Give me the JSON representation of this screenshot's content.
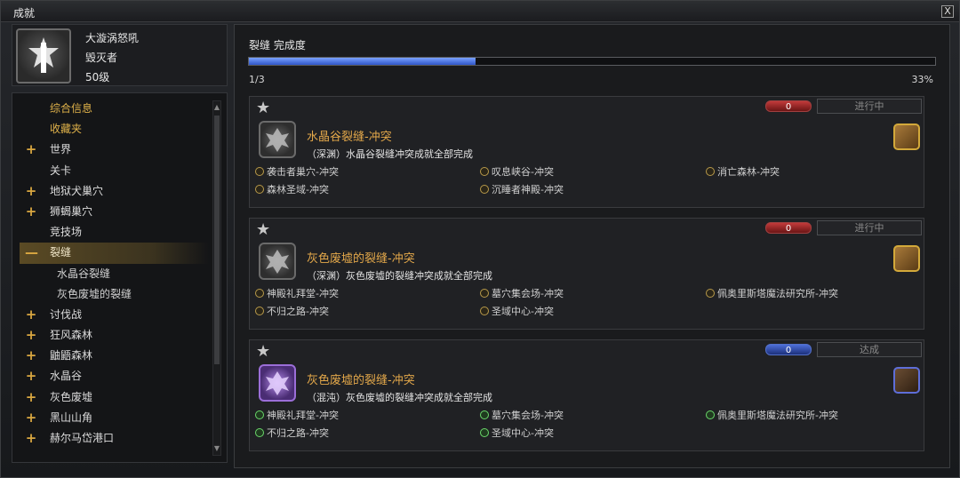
{
  "window": {
    "title": "成就",
    "close_label": "X"
  },
  "profile": {
    "name": "大漩涡怒吼",
    "class": "毁灭者",
    "level": "50级"
  },
  "tree": {
    "items": [
      {
        "symbol": "",
        "label": "综合信息",
        "style": "gold"
      },
      {
        "symbol": "",
        "label": "收藏夹",
        "style": "gold"
      },
      {
        "symbol": "+",
        "label": "世界",
        "style": "normal"
      },
      {
        "symbol": "",
        "label": "关卡",
        "style": "normal"
      },
      {
        "symbol": "+",
        "label": "地狱犬巢穴",
        "style": "normal"
      },
      {
        "symbol": "+",
        "label": "狮蝎巢穴",
        "style": "normal"
      },
      {
        "symbol": "",
        "label": "竞技场",
        "style": "normal"
      },
      {
        "symbol": "—",
        "label": "裂缝",
        "style": "active"
      },
      {
        "symbol": "",
        "label": "水晶谷裂缝",
        "style": "sub"
      },
      {
        "symbol": "",
        "label": "灰色废墟的裂缝",
        "style": "sub"
      },
      {
        "symbol": "+",
        "label": "讨伐战",
        "style": "normal"
      },
      {
        "symbol": "+",
        "label": "狂风森林",
        "style": "normal"
      },
      {
        "symbol": "+",
        "label": "鼬鼯森林",
        "style": "normal"
      },
      {
        "symbol": "+",
        "label": "水晶谷",
        "style": "normal"
      },
      {
        "symbol": "+",
        "label": "灰色废墟",
        "style": "normal"
      },
      {
        "symbol": "+",
        "label": "黑山山角",
        "style": "normal"
      },
      {
        "symbol": "+",
        "label": "赫尔马岱港口",
        "style": "normal"
      }
    ]
  },
  "progress": {
    "title": "裂缝 完成度",
    "count": "1/3",
    "percent_label": "33%",
    "fraction": 0.33
  },
  "cards": [
    {
      "counter": "0",
      "counter_color": "red",
      "status": "进行中",
      "badge": "gray",
      "reward": "gold",
      "title": "水晶谷裂缝-冲突",
      "desc": "（深渊）水晶谷裂缝冲突成就全部完成",
      "subs": [
        {
          "label": "袭击者巢穴-冲突",
          "done": false
        },
        {
          "label": "叹息峡谷-冲突",
          "done": false
        },
        {
          "label": "消亡森林-冲突",
          "done": false
        },
        {
          "label": "森林圣域-冲突",
          "done": false
        },
        {
          "label": "沉睡者神殿-冲突",
          "done": false
        }
      ]
    },
    {
      "counter": "0",
      "counter_color": "red",
      "status": "进行中",
      "badge": "gray",
      "reward": "gold",
      "title": "灰色废墟的裂缝-冲突",
      "desc": "（深渊）灰色废墟的裂缝冲突成就全部完成",
      "subs": [
        {
          "label": "神殿礼拜堂-冲突",
          "done": false
        },
        {
          "label": "墓穴集会场-冲突",
          "done": false
        },
        {
          "label": "佩奥里斯塔魔法研究所-冲突",
          "done": false
        },
        {
          "label": "不归之路-冲突",
          "done": false
        },
        {
          "label": "圣域中心-冲突",
          "done": false
        }
      ]
    },
    {
      "counter": "0",
      "counter_color": "blue",
      "status": "达成",
      "badge": "purple",
      "reward": "blue",
      "title": "灰色废墟的裂缝-冲突",
      "desc": "（混沌）灰色废墟的裂缝冲突成就全部完成",
      "subs": [
        {
          "label": "神殿礼拜堂-冲突",
          "done": true
        },
        {
          "label": "墓穴集会场-冲突",
          "done": true
        },
        {
          "label": "佩奥里斯塔魔法研究所-冲突",
          "done": true
        },
        {
          "label": "不归之路-冲突",
          "done": true
        },
        {
          "label": "圣域中心-冲突",
          "done": true
        }
      ]
    }
  ]
}
